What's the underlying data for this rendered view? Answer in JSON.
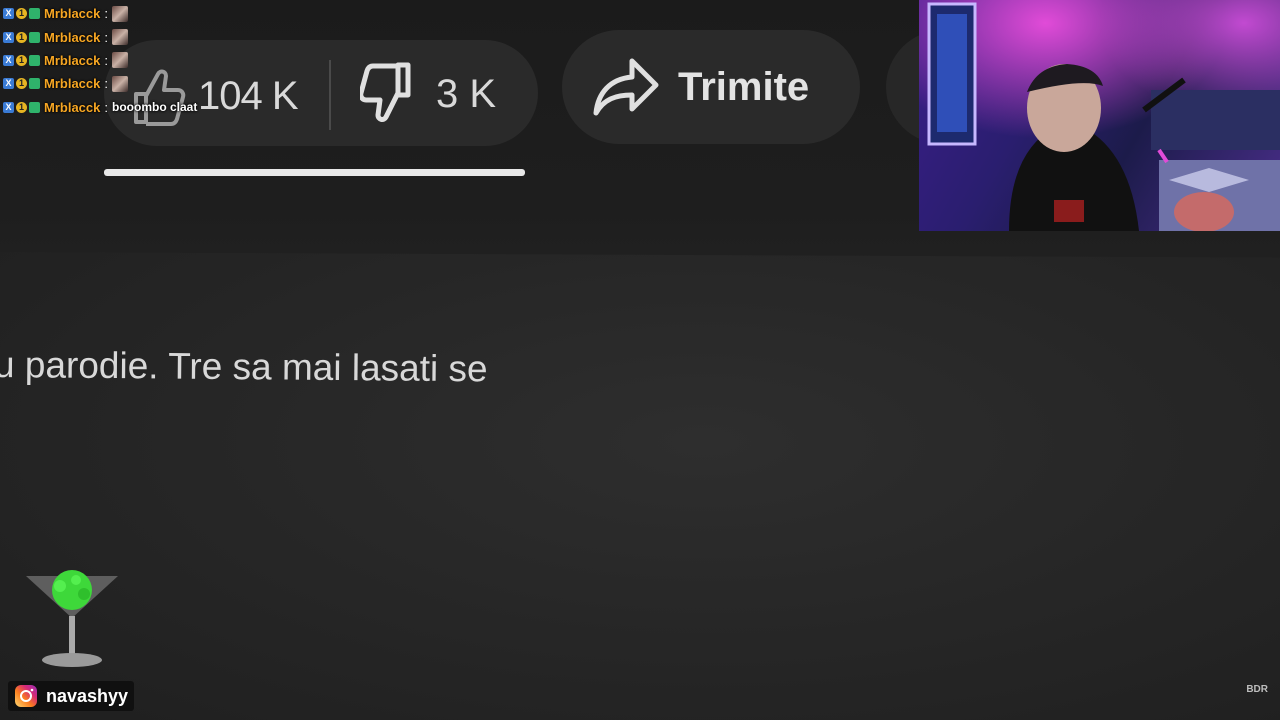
{
  "video_actions": {
    "like_count": "104 K",
    "dislike_count": "3 K",
    "share_label": "Trimite",
    "like_ratio": 0.97
  },
  "description": {
    "text": "u parodie. Tre sa mai lasati se"
  },
  "chat": {
    "messages": [
      {
        "user": "Mrblacck",
        "separator": ":",
        "message": ""
      },
      {
        "user": "Mrblacck",
        "separator": ":",
        "message": ""
      },
      {
        "user": "Mrblacck",
        "separator": ":",
        "message": ""
      },
      {
        "user": "Mrblacck",
        "separator": ":",
        "message": ""
      },
      {
        "user": "Mrblacck",
        "separator": ":",
        "message": "booombo claat"
      }
    ],
    "badge_labels": {
      "x": "X",
      "coin": "1"
    }
  },
  "overlay": {
    "instagram_handle": "navashyy",
    "watermark": "BDR"
  },
  "colors": {
    "chat_username": "#f6a623",
    "background": "#242424",
    "pill": "#2a2a2a"
  },
  "icons": {
    "like": "thumb-up-icon",
    "dislike": "thumb-down-icon",
    "share": "share-arrow-icon",
    "instagram": "instagram-icon",
    "cocktail": "cocktail-glass-icon"
  }
}
